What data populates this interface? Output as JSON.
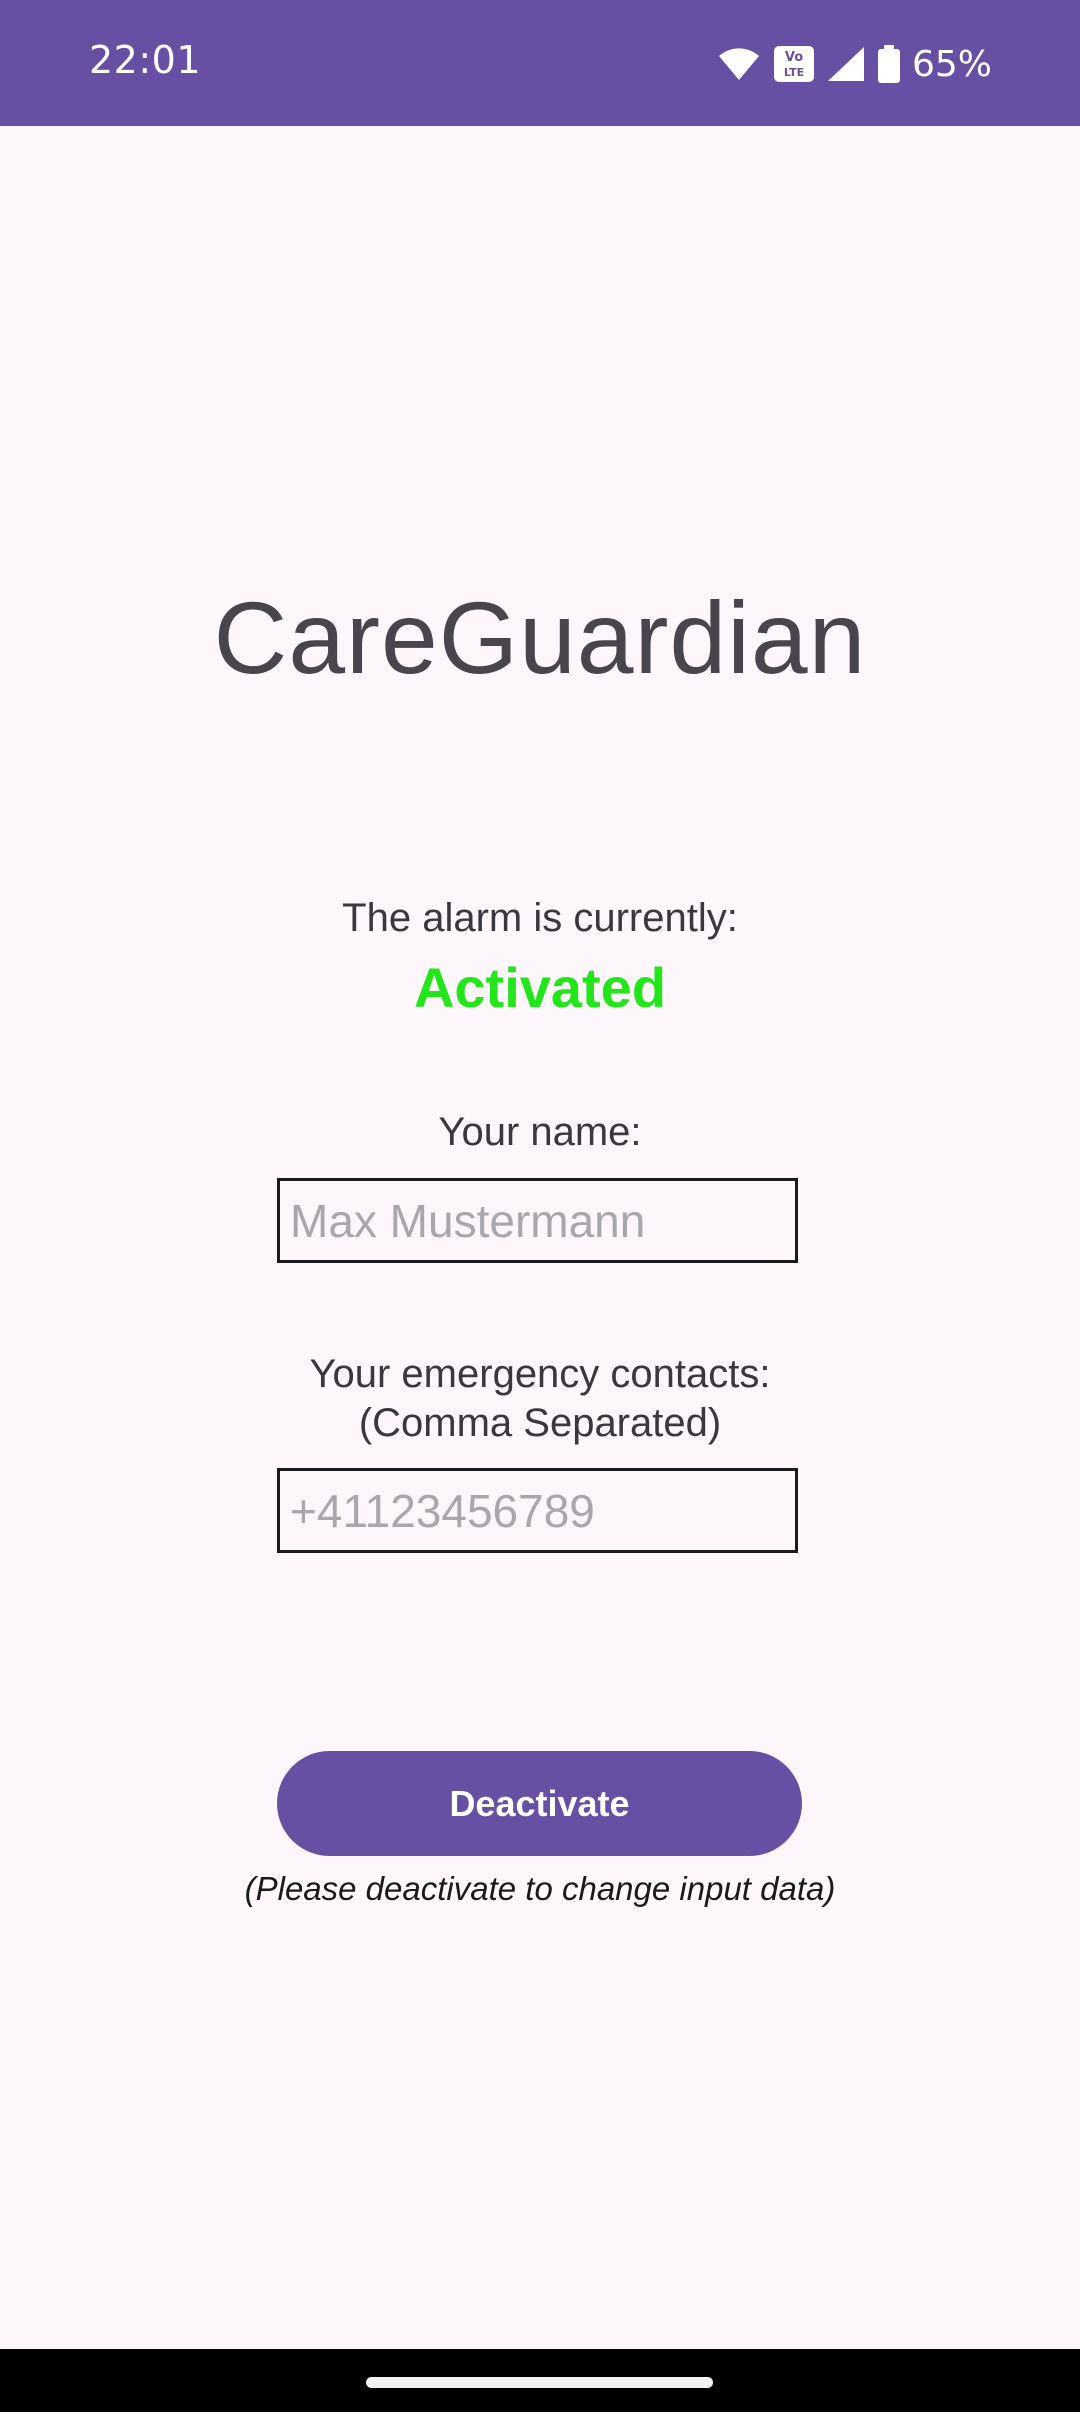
{
  "status_bar": {
    "time": "22:01",
    "battery_percent": "65%",
    "volte_label": "Vo LTE",
    "icons": [
      "wifi-icon",
      "volte-icon",
      "signal-icon",
      "battery-icon"
    ],
    "background_color": "#6750a4"
  },
  "app": {
    "title": "CareGuardian"
  },
  "alarm": {
    "label": "The alarm is currently:",
    "status": "Activated",
    "status_color": "#22e61a"
  },
  "form": {
    "name_label": "Your name:",
    "name_value": "",
    "name_placeholder": "Max Mustermann",
    "contacts_label_line1": "Your emergency contacts:",
    "contacts_label_line2": "(Comma Separated)",
    "contacts_value": "",
    "contacts_placeholder": "+41123456789"
  },
  "action": {
    "button_label": "Deactivate",
    "hint": "(Please deactivate to change input data)"
  }
}
